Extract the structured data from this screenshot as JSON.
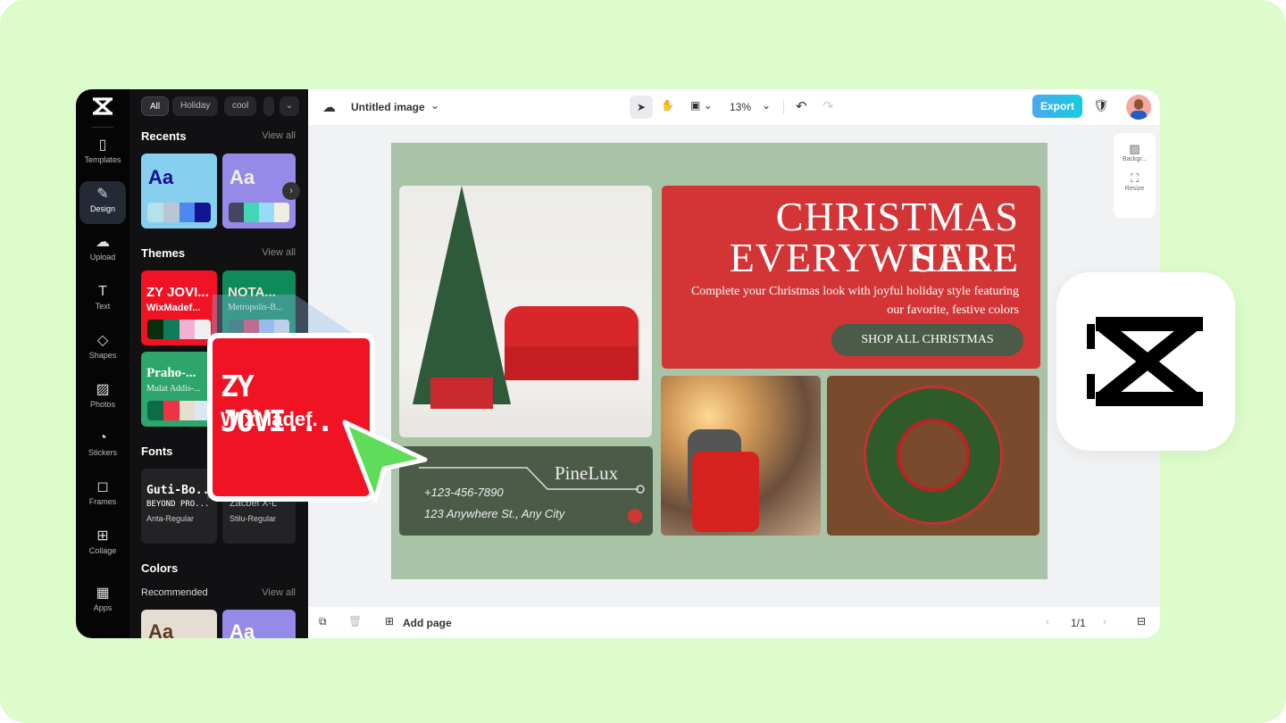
{
  "rail": {
    "items": [
      {
        "label": "Templates",
        "icon": "templates-icon"
      },
      {
        "label": "Design",
        "icon": "design-icon"
      },
      {
        "label": "Upload",
        "icon": "upload-icon"
      },
      {
        "label": "Text",
        "icon": "text-icon"
      },
      {
        "label": "Shapes",
        "icon": "shapes-icon"
      },
      {
        "label": "Photos",
        "icon": "photos-icon"
      },
      {
        "label": "Stickers",
        "icon": "stickers-icon"
      },
      {
        "label": "Frames",
        "icon": "frames-icon"
      },
      {
        "label": "Collage",
        "icon": "collage-icon"
      },
      {
        "label": "Apps",
        "icon": "apps-icon"
      }
    ]
  },
  "panel": {
    "chips": [
      "All",
      "Holiday",
      "cool"
    ],
    "recents": {
      "title": "Recents",
      "view_all": "View all",
      "cards": [
        {
          "sample": "Aa",
          "colors": [
            "#b4e1ea",
            "#bac6d6",
            "#4d87f0",
            "#131494"
          ]
        },
        {
          "sample": "Aa",
          "colors": [
            "#464462",
            "#42d6b3",
            "#96dcf8",
            "#f1ede0"
          ]
        }
      ]
    },
    "themes": {
      "title": "Themes",
      "view_all": "View all",
      "cards": [
        {
          "title": "ZY JOVI...",
          "sub": "WixMadef...",
          "colors": [
            "#0a2f0c",
            "#0f7d5a",
            "#f3b0d2",
            "#eef0f0"
          ]
        },
        {
          "title": "NOTA...",
          "sub": "Metropolis-B...",
          "colors": [
            "#2d6b5e",
            "#d64560",
            "#9cbef0",
            "#d7dde6"
          ]
        },
        {
          "title": "Praho-...",
          "sub": "Mulat Addis-...",
          "colors": [
            "#0c6b4b",
            "#ef3344",
            "#e5dfcc",
            "#d9e8f2"
          ]
        }
      ]
    },
    "fonts": {
      "title": "Fonts",
      "cards": [
        {
          "line1": "Guti-Bo...",
          "line2": "BEYOND PRO...",
          "name": "Anta-Regular"
        },
        {
          "line1": "Zacbel X-L",
          "name": "Stilu-Regular"
        }
      ]
    },
    "colors": {
      "title": "Colors",
      "sub": "Recommended",
      "view_all": "View all",
      "cards": [
        {
          "sample": "Aa"
        },
        {
          "sample": "Aa"
        }
      ]
    }
  },
  "topbar": {
    "title": "Untitled image",
    "zoom": "13%",
    "export": "Export"
  },
  "side_tools": [
    "Backgr...",
    "Resize"
  ],
  "bottombar": {
    "add_page": "Add page",
    "page": "1/1"
  },
  "design": {
    "headline1": "CHRISTMAS SALE",
    "headline2": "EVERYWHERE",
    "body": "Complete your Christmas look with joyful holiday style featuring our favorite, festive colors",
    "cta": "SHOP ALL CHRISTMAS",
    "brand": "PineLux",
    "phone": "+123-456-7890",
    "address": "123 Anywhere St., Any City"
  },
  "popup": {
    "title": "ZY JOVI...",
    "sub": "WixMadef.",
    "colors": [
      "#0a2f0c",
      "#06704f",
      "#f7a9cc",
      "#faf5ea"
    ]
  },
  "colors": {
    "accent": "#1fb8e8",
    "design_red": "#d33536",
    "design_green": "#4c5b48",
    "canvas_bg": "#a9c3a6"
  }
}
